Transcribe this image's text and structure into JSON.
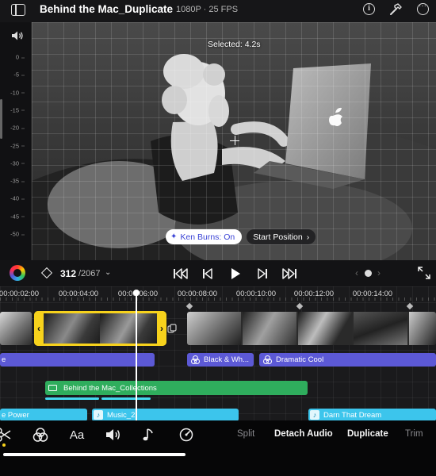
{
  "header": {
    "project_title": "Behind the Mac_Duplicate",
    "format": "1080P · 25 FPS"
  },
  "meter": {
    "ticks": [
      "0",
      "-5",
      "-10",
      "-15",
      "-20",
      "-25",
      "-30",
      "-35",
      "-40",
      "-45",
      "-50"
    ]
  },
  "preview": {
    "selected_label": "Selected: 4.2s",
    "ken_burns_label": "Ken Burns: On",
    "start_position_label": "Start Position"
  },
  "playback": {
    "current_frame": "312",
    "total_frames": "/2067"
  },
  "timeline": {
    "ruler_labels": [
      "00:00:02:00",
      "00:00:04:00",
      "00:00:06:00",
      "00:00:08:00",
      "00:00:10:00",
      "00:00:12:00",
      "00:00:14:00"
    ],
    "effects": [
      {
        "label": "e"
      },
      {
        "label": "Black & Wh..."
      },
      {
        "label": "Dramatic Cool"
      }
    ],
    "title_clip": "Behind the Mac_Collections",
    "audio_clips": [
      {
        "label": "e Power"
      },
      {
        "label": "Music_2"
      },
      {
        "label": "Darn That Dream"
      }
    ]
  },
  "toolbar": {
    "split": "Split",
    "detach_audio": "Detach Audio",
    "duplicate": "Duplicate",
    "trim": "Trim",
    "text_tool": "Aa"
  },
  "colors": {
    "selection": "#f7d21c",
    "effect": "#5c59d6",
    "title": "#2fad5d",
    "audio": "#3cc5ec",
    "ken_burns_text": "#3b44d6"
  }
}
